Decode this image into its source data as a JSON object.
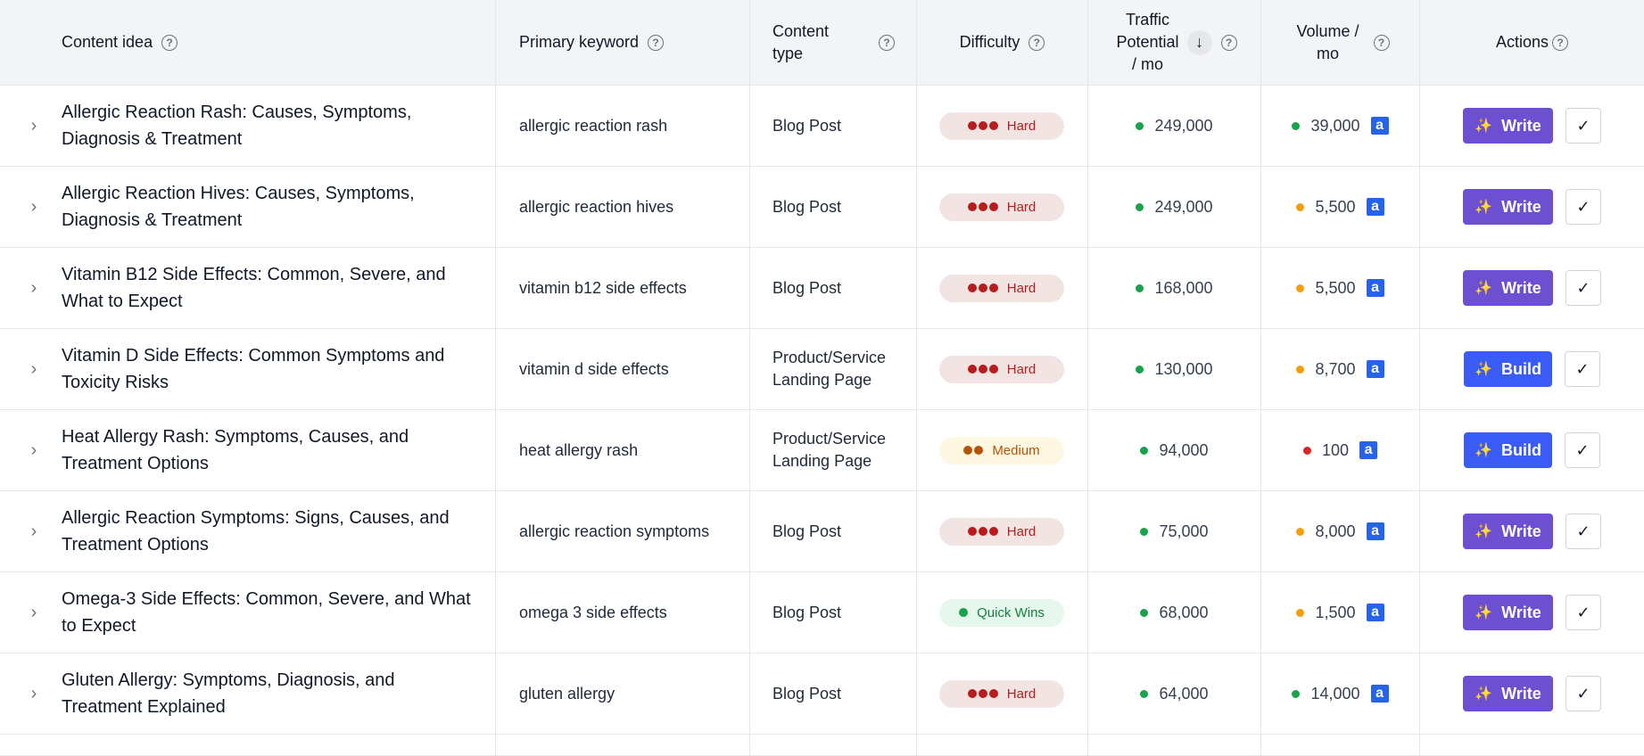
{
  "header": {
    "content_idea": "Content idea",
    "primary_keyword": "Primary keyword",
    "content_type": "Content type",
    "difficulty": "Difficulty",
    "traffic_potential": "Traffic Potential / mo",
    "volume": "Volume / mo",
    "actions": "Actions",
    "help_icon": "?",
    "sort_icon": "↓"
  },
  "colors": {
    "green": "#16a34a",
    "orange": "#f59e0b",
    "red": "#dc2626",
    "write_button": "#6d4fd1",
    "build_button": "#3b5bf6"
  },
  "rows": [
    {
      "idea": "Allergic Reaction Rash: Causes, Symptoms, Diagnosis & Treatment",
      "keyword": "allergic reaction rash",
      "type": "Blog Post",
      "difficulty": "Hard",
      "traffic": "249,000",
      "traffic_status": "green",
      "volume": "39,000",
      "volume_status": "green",
      "action": "Write"
    },
    {
      "idea": "Allergic Reaction Hives: Causes, Symptoms, Diagnosis & Treatment",
      "keyword": "allergic reaction hives",
      "type": "Blog Post",
      "difficulty": "Hard",
      "traffic": "249,000",
      "traffic_status": "green",
      "volume": "5,500",
      "volume_status": "orange",
      "action": "Write"
    },
    {
      "idea": "Vitamin B12 Side Effects: Common, Severe, and What to Expect",
      "keyword": "vitamin b12 side effects",
      "type": "Blog Post",
      "difficulty": "Hard",
      "traffic": "168,000",
      "traffic_status": "green",
      "volume": "5,500",
      "volume_status": "orange",
      "action": "Write"
    },
    {
      "idea": "Vitamin D Side Effects: Common Symptoms and Toxicity Risks",
      "keyword": "vitamin d side effects",
      "type": "Product/Service Landing Page",
      "difficulty": "Hard",
      "traffic": "130,000",
      "traffic_status": "green",
      "volume": "8,700",
      "volume_status": "orange",
      "action": "Build"
    },
    {
      "idea": "Heat Allergy Rash: Symptoms, Causes, and Treatment Options",
      "keyword": "heat allergy rash",
      "type": "Product/Service Landing Page",
      "difficulty": "Medium",
      "traffic": "94,000",
      "traffic_status": "green",
      "volume": "100",
      "volume_status": "red",
      "action": "Build"
    },
    {
      "idea": "Allergic Reaction Symptoms: Signs, Causes, and Treatment Options",
      "keyword": "allergic reaction symptoms",
      "type": "Blog Post",
      "difficulty": "Hard",
      "traffic": "75,000",
      "traffic_status": "green",
      "volume": "8,000",
      "volume_status": "orange",
      "action": "Write"
    },
    {
      "idea": "Omega-3 Side Effects: Common, Severe, and What to Expect",
      "keyword": "omega 3 side effects",
      "type": "Blog Post",
      "difficulty": "Quick Wins",
      "traffic": "68,000",
      "traffic_status": "green",
      "volume": "1,500",
      "volume_status": "orange",
      "action": "Write"
    },
    {
      "idea": "Gluten Allergy: Symptoms, Diagnosis, and Treatment Explained",
      "keyword": "gluten allergy",
      "type": "Blog Post",
      "difficulty": "Hard",
      "traffic": "64,000",
      "traffic_status": "green",
      "volume": "14,000",
      "volume_status": "green",
      "action": "Write"
    }
  ]
}
